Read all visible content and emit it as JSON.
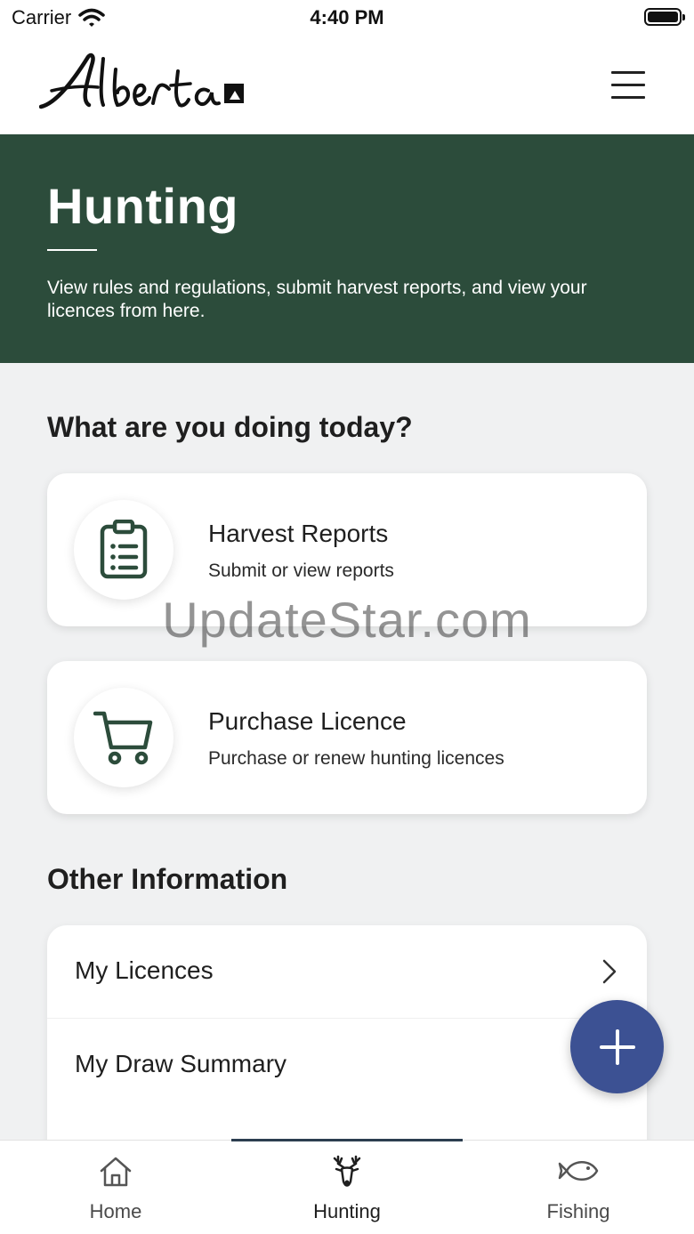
{
  "status_bar": {
    "carrier": "Carrier",
    "time": "4:40 PM"
  },
  "header": {
    "logo_text": "Alberta"
  },
  "hero": {
    "title": "Hunting",
    "description": "View rules and regulations, submit harvest reports, and view your licences from here.",
    "background_color": "#2c4c3b"
  },
  "actions": {
    "heading": "What are you doing today?",
    "cards": [
      {
        "title": "Harvest Reports",
        "subtitle": "Submit or view reports",
        "icon": "clipboard-icon"
      },
      {
        "title": "Purchase Licence",
        "subtitle": "Purchase or renew hunting licences",
        "icon": "cart-icon"
      }
    ]
  },
  "other_info": {
    "heading": "Other Information",
    "items": [
      {
        "label": "My Licences"
      },
      {
        "label": "My Draw Summary"
      }
    ]
  },
  "watermark": "UpdateStar.com",
  "fab": {
    "icon": "plus-icon",
    "color": "#3c5193"
  },
  "tabbar": {
    "tabs": [
      {
        "label": "Home",
        "icon": "home-icon"
      },
      {
        "label": "Hunting",
        "icon": "deer-icon",
        "active": true
      },
      {
        "label": "Fishing",
        "icon": "fish-icon"
      }
    ]
  },
  "colors": {
    "accent_green": "#2c4c3b",
    "fab_blue": "#3c5193"
  }
}
